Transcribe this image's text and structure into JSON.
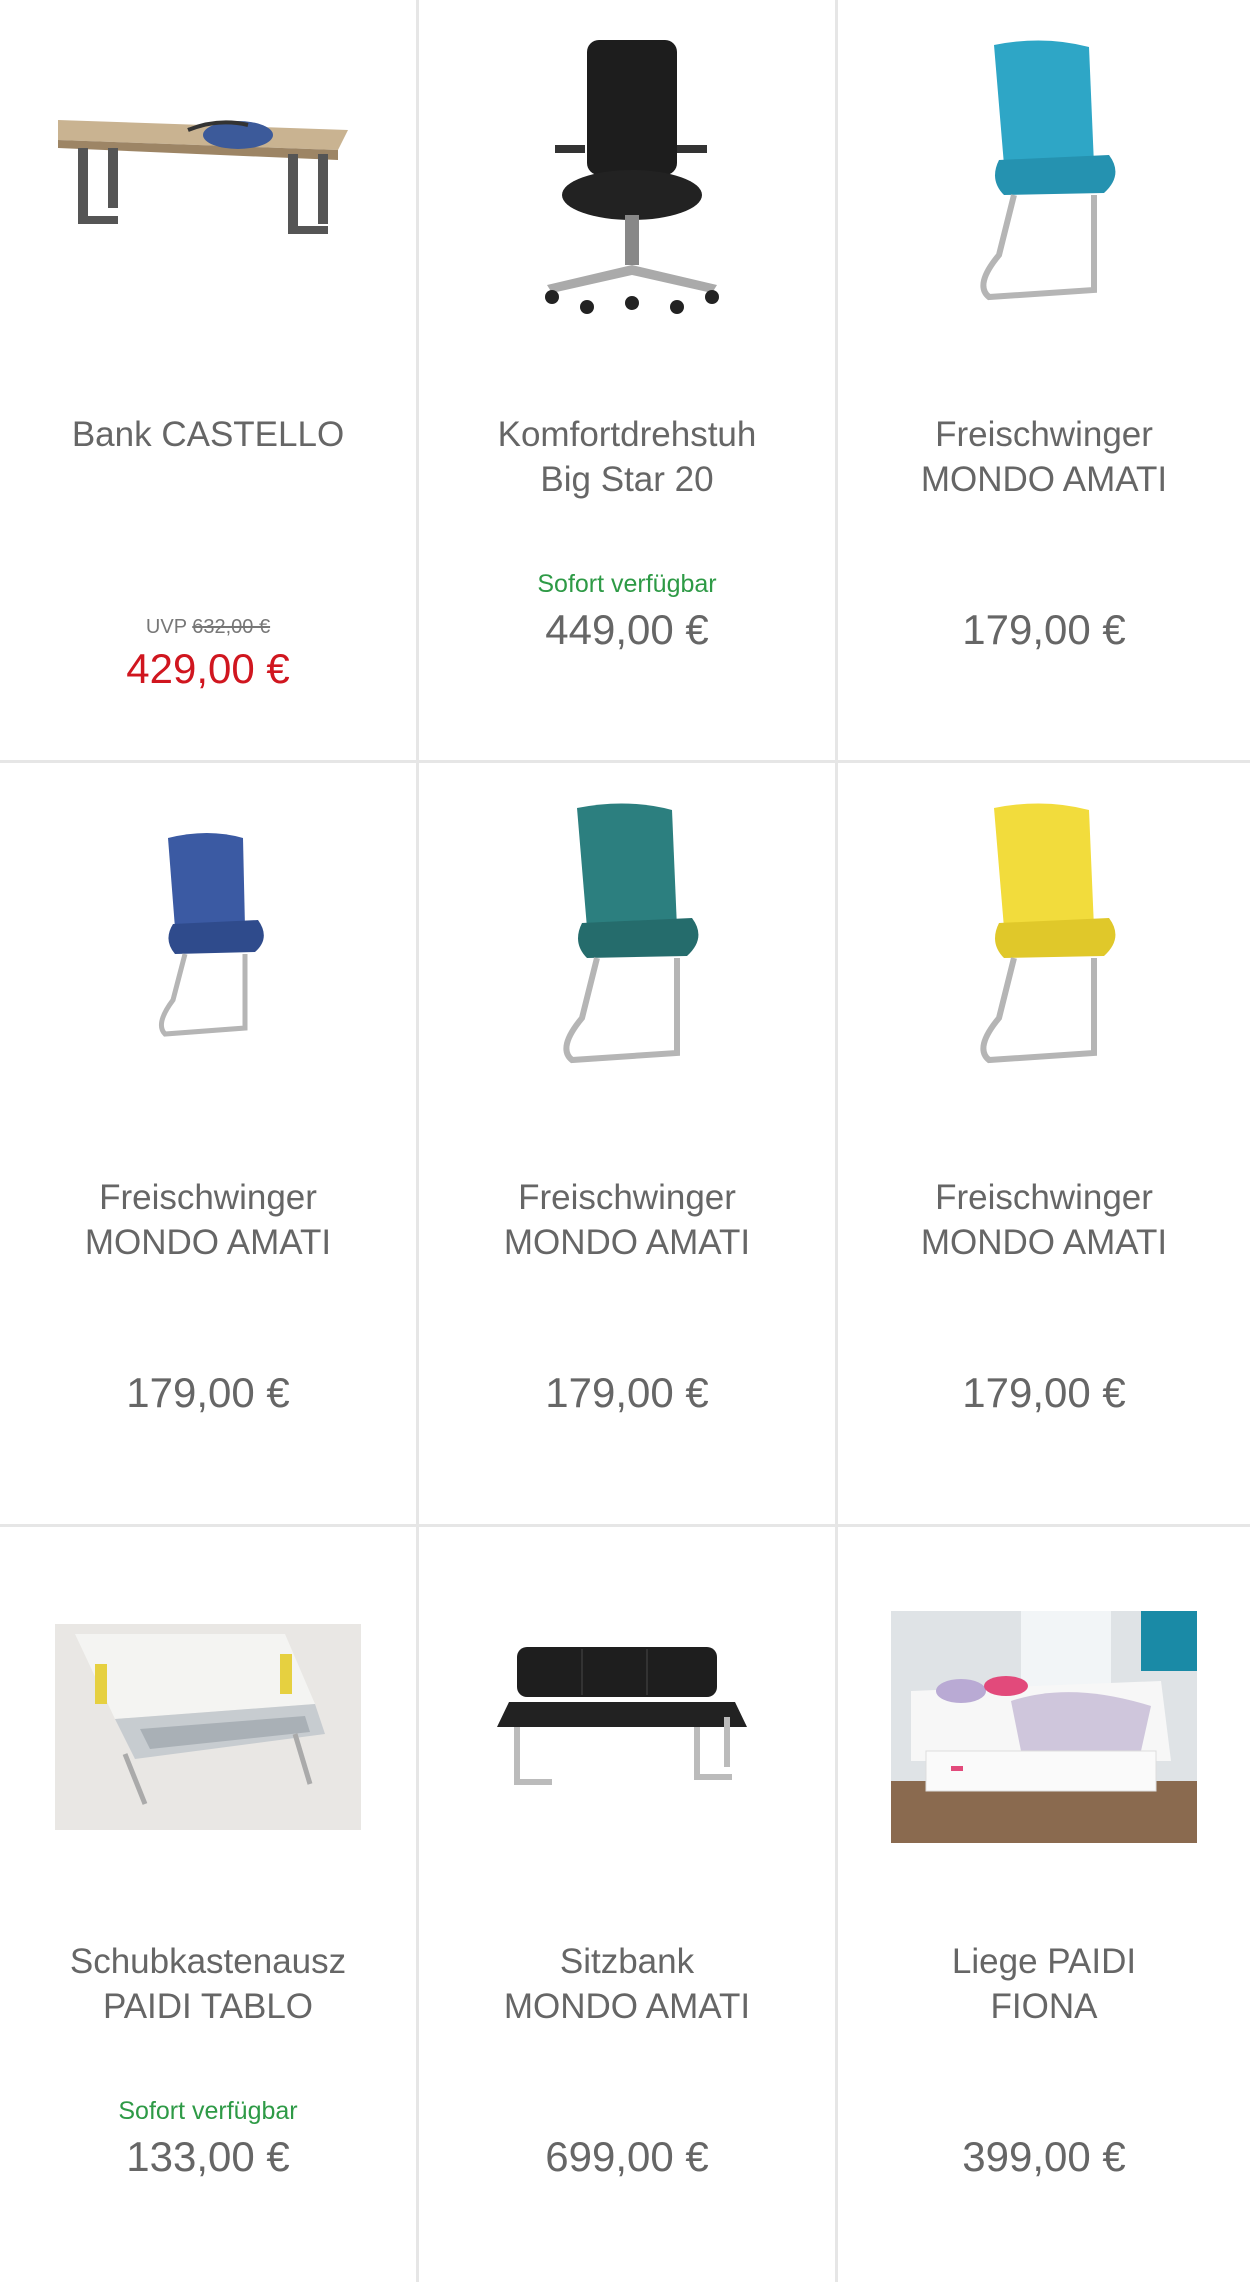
{
  "products": [
    {
      "name_line1": "Bank CASTELLO",
      "name_line2": "",
      "availability": "",
      "uvp_label": "UVP",
      "uvp_price": "632,00 €",
      "price": "429,00 €",
      "image": "bench-image",
      "accent": "#d0161f"
    },
    {
      "name_line1": "Komfortdrehstuh",
      "name_line2": "Big Star 20",
      "availability": "Sofort verfügbar",
      "uvp_label": "",
      "uvp_price": "",
      "price": "449,00 €",
      "image": "office-chair-image"
    },
    {
      "name_line1": "Freischwinger",
      "name_line2": "MONDO AMATI",
      "availability": "",
      "uvp_label": "",
      "uvp_price": "",
      "price": "179,00 €",
      "image": "cantilever-chair-image",
      "chair_color": "#2ea6c6"
    },
    {
      "name_line1": "Freischwinger",
      "name_line2": "MONDO AMATI",
      "availability": "",
      "uvp_label": "",
      "uvp_price": "",
      "price": "179,00 €",
      "image": "cantilever-chair-image",
      "chair_color": "#3b5aa3"
    },
    {
      "name_line1": "Freischwinger",
      "name_line2": "MONDO AMATI",
      "availability": "",
      "uvp_label": "",
      "uvp_price": "",
      "price": "179,00 €",
      "image": "cantilever-chair-image",
      "chair_color": "#2c7f7f"
    },
    {
      "name_line1": "Freischwinger",
      "name_line2": "MONDO AMATI",
      "availability": "",
      "uvp_label": "",
      "uvp_price": "",
      "price": "179,00 €",
      "image": "cantilever-chair-image",
      "chair_color": "#f2dc3c"
    },
    {
      "name_line1": "Schubkastenausz",
      "name_line2": "PAIDI TABLO",
      "availability": "Sofort verfügbar",
      "uvp_label": "",
      "uvp_price": "",
      "price": "133,00 €",
      "image": "drawer-image"
    },
    {
      "name_line1": "Sitzbank",
      "name_line2": "MONDO AMATI",
      "availability": "",
      "uvp_label": "",
      "uvp_price": "",
      "price": "699,00 €",
      "image": "sitting-bench-image"
    },
    {
      "name_line1": "Liege PAIDI",
      "name_line2": "FIONA",
      "availability": "",
      "uvp_label": "",
      "uvp_price": "",
      "price": "399,00 €",
      "image": "daybed-image"
    }
  ],
  "colors": {
    "availability": "#2e9a46",
    "sale": "#d0161f",
    "text": "#666666",
    "divider": "#e6e6e6"
  }
}
